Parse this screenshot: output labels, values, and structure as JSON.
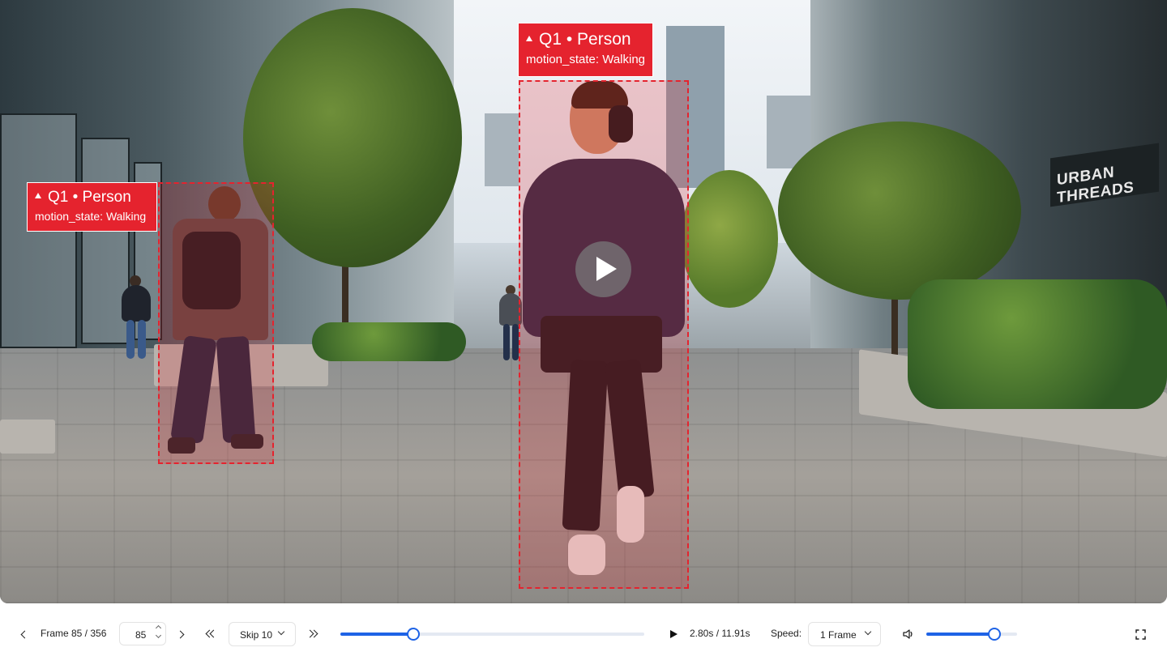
{
  "detections": [
    {
      "title": "Q1 • Person",
      "attribute": "motion_state: Walking"
    },
    {
      "title": "Q1 • Person",
      "attribute": "motion_state: Walking"
    }
  ],
  "scene": {
    "store_sign": "URBAN THREADS"
  },
  "player": {
    "state": "paused",
    "frame_label": "Frame 85 / 356",
    "frame_input_value": "85",
    "skip_select": "Skip 10",
    "timeline_progress": 0.24,
    "time_label": "2.80s / 11.91s",
    "speed_label": "Speed:",
    "speed_select": "1 Frame",
    "volume": 0.75
  },
  "colors": {
    "bbox": "#e5232e",
    "accent": "#1e63e6"
  },
  "icons": [
    "play-icon",
    "prev-frame-icon",
    "next-frame-icon",
    "skip-back-icon",
    "skip-forward-icon",
    "volume-icon",
    "fullscreen-icon",
    "chevron-down-icon"
  ]
}
